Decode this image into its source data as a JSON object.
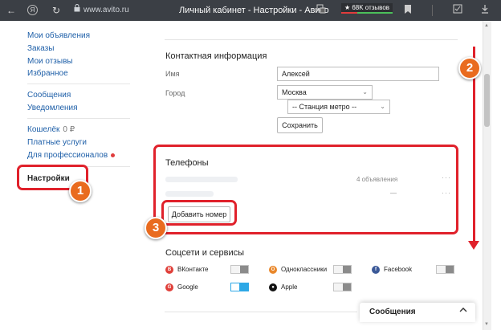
{
  "browser": {
    "url": "www.avito.ru",
    "tab_title": "Личный кабинет - Настройки - Авито",
    "reviews_badge": "★ 68K отзывов"
  },
  "sidebar": {
    "group1": [
      "Мои объявления",
      "Заказы",
      "Мои отзывы",
      "Избранное"
    ],
    "group2": [
      "Сообщения",
      "Уведомления"
    ],
    "wallet_label": "Кошелёк",
    "wallet_amount": "0 ₽",
    "paid_services": "Платные услуги",
    "for_professionals": "Для профессионалов",
    "settings": "Настройки"
  },
  "contact": {
    "title": "Контактная информация",
    "name_label": "Имя",
    "name_value": "Алексей",
    "city_label": "Город",
    "city_value": "Москва",
    "metro_value": "-- Станция метро --",
    "save_label": "Сохранить"
  },
  "phones": {
    "title": "Телефоны",
    "rows": [
      {
        "meta": "4 объявления",
        "menu": "···"
      },
      {
        "meta": "—",
        "menu": "···"
      }
    ],
    "add_label": "Добавить номер"
  },
  "social": {
    "title": "Соцсети и сервисы",
    "items": [
      {
        "label": "ВКонтакте",
        "on": false,
        "color": "#e0403a",
        "glyph": "В"
      },
      {
        "label": "Одноклассники",
        "on": false,
        "color": "#e9872a",
        "glyph": "О"
      },
      {
        "label": "Facebook",
        "on": false,
        "color": "#3b5998",
        "glyph": "f"
      },
      {
        "label": "Google",
        "on": true,
        "color": "#e0403a",
        "glyph": "G"
      },
      {
        "label": "Apple",
        "on": false,
        "color": "#111111",
        "glyph": "●"
      }
    ]
  },
  "annotations": {
    "step1": "1",
    "step2": "2",
    "step3": "3",
    "highlight_color": "#e0212b",
    "badge_color": "#e96b1f"
  },
  "messages_widget": {
    "title": "Сообщения",
    "chevron": "^"
  },
  "toolbar_icons": {
    "back": "←",
    "yandex": "Я",
    "reload": "↻",
    "lock": "🔒"
  }
}
